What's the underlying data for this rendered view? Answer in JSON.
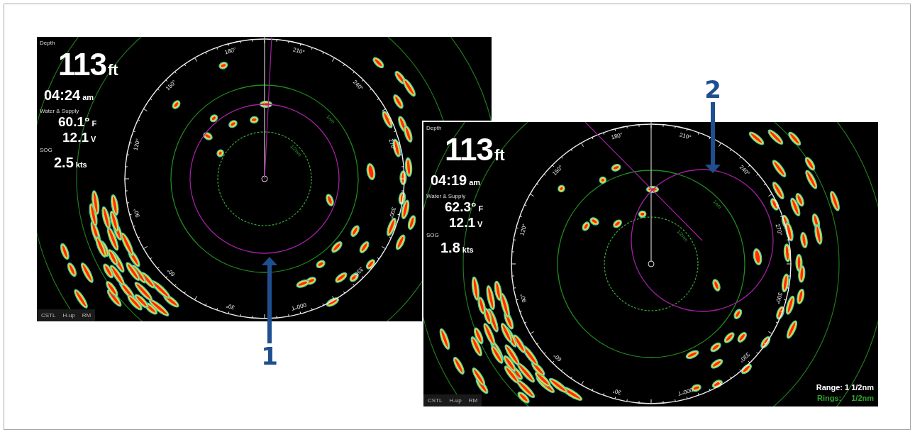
{
  "screens": [
    {
      "data_panel": {
        "depth_label": "Depth",
        "depth": "113",
        "depth_unit": "ft",
        "time": "04:24",
        "time_suffix": "am",
        "supply_label": "Water & Supply",
        "water_temp": "60.1°",
        "water_temp_unit": "F",
        "voltage": "12.1",
        "voltage_unit": "V",
        "sog_label": "SOG",
        "sog": "2.5",
        "sog_unit": "kts"
      },
      "bearing_labels": [
        "180°",
        "210°",
        "240°",
        "270°",
        "300°",
        "330°",
        "000°T",
        "30°",
        "60°",
        "90°",
        "120°",
        "150°"
      ],
      "ring_labels": [
        "1nm",
        "1/2nm"
      ],
      "mode_bar": [
        "CSTL",
        "H-up",
        "RM"
      ],
      "kind": "centered"
    },
    {
      "data_panel": {
        "depth_label": "Depth",
        "depth": "113",
        "depth_unit": "ft",
        "time": "04:19",
        "time_suffix": "am",
        "supply_label": "Water & Supply",
        "water_temp": "62.3°",
        "water_temp_unit": "F",
        "voltage": "12.1",
        "voltage_unit": "V",
        "sog_label": "SOG",
        "sog": "1.8",
        "sog_unit": "kts"
      },
      "bearing_labels": [
        "180°",
        "210°",
        "240°",
        "270°",
        "300°",
        "330°",
        "000°T",
        "30°",
        "60°",
        "90°",
        "120°",
        "150°"
      ],
      "ring_labels": [
        "1nm",
        "1/2nm"
      ],
      "mode_bar": [
        "CSTL",
        "H-up",
        "RM"
      ],
      "kind": "offset",
      "range_info": {
        "range": "Range: 1 1/2nm",
        "rings_label": "Rings:",
        "rings_value": "1/2nm"
      }
    }
  ],
  "callouts": [
    {
      "number": "1",
      "kind": "up"
    },
    {
      "number": "2",
      "kind": "down"
    }
  ]
}
